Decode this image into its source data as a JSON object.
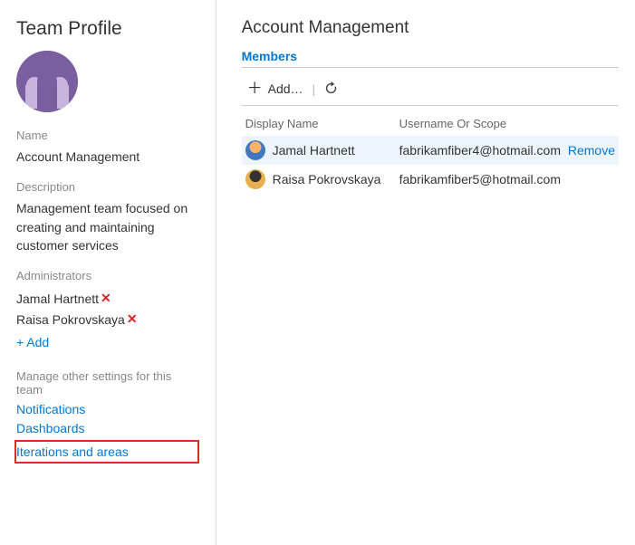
{
  "sidebar": {
    "title": "Team Profile",
    "name_label": "Name",
    "name_value": "Account Management",
    "desc_label": "Description",
    "desc_value": "Management team focused on creating and maintaining customer services",
    "admins_label": "Administrators",
    "admins": [
      {
        "name": "Jamal Hartnett"
      },
      {
        "name": "Raisa Pokrovskaya"
      }
    ],
    "add_label": "+ Add",
    "manage_label": "Manage other settings for this team",
    "settings": [
      {
        "label": "Notifications"
      },
      {
        "label": "Dashboards"
      },
      {
        "label": "Iterations and areas"
      }
    ]
  },
  "main": {
    "title": "Account Management",
    "tab_members": "Members",
    "add_button": "Add…",
    "columns": {
      "name": "Display Name",
      "user": "Username Or Scope"
    },
    "remove_label": "Remove",
    "rows": [
      {
        "name": "Jamal Hartnett",
        "user": "fabrikamfiber4@hotmail.com",
        "hover": true
      },
      {
        "name": "Raisa Pokrovskaya",
        "user": "fabrikamfiber5@hotmail.com",
        "hover": false
      }
    ]
  }
}
